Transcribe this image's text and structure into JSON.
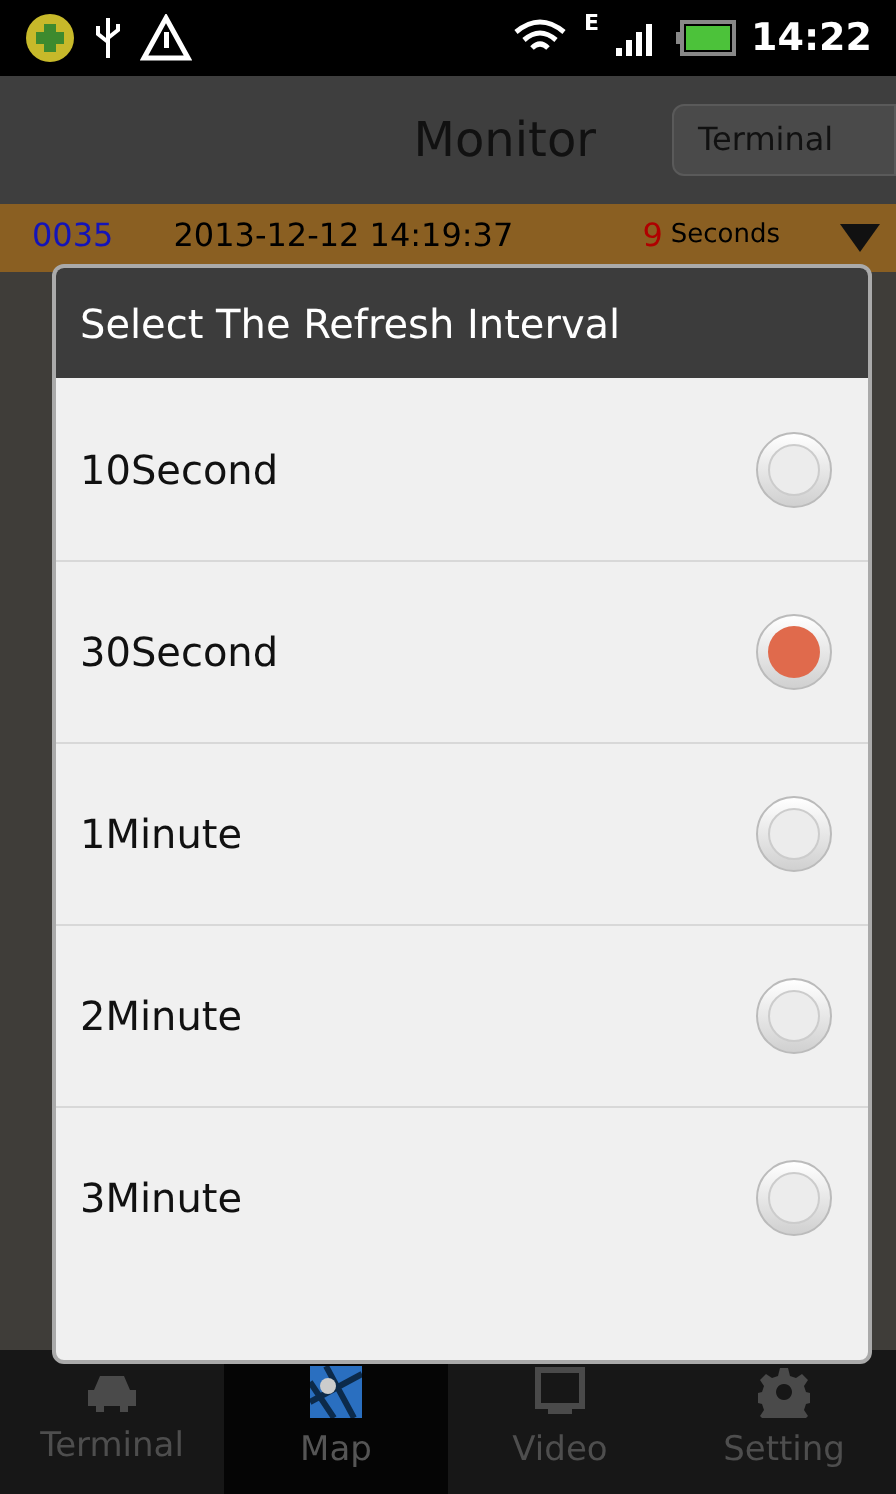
{
  "status_bar": {
    "time": "14:22",
    "network_letter": "E"
  },
  "header": {
    "title": "Monitor",
    "button": "Terminal"
  },
  "info_row": {
    "id": "0035",
    "datetime": "2013-12-12 14:19:37",
    "count": "9",
    "unit": "Seconds"
  },
  "dialog": {
    "title": "Select The Refresh Interval",
    "options": [
      {
        "label": "10Second",
        "selected": false
      },
      {
        "label": "30Second",
        "selected": true
      },
      {
        "label": "1Minute",
        "selected": false
      },
      {
        "label": "2Minute",
        "selected": false
      },
      {
        "label": "3Minute",
        "selected": false
      }
    ]
  },
  "tabs": [
    {
      "label": "Terminal",
      "kind": "car",
      "selected": false
    },
    {
      "label": "Map",
      "kind": "map",
      "selected": true
    },
    {
      "label": "Video",
      "kind": "monitor",
      "selected": false
    },
    {
      "label": "Setting",
      "kind": "gear",
      "selected": false
    }
  ]
}
